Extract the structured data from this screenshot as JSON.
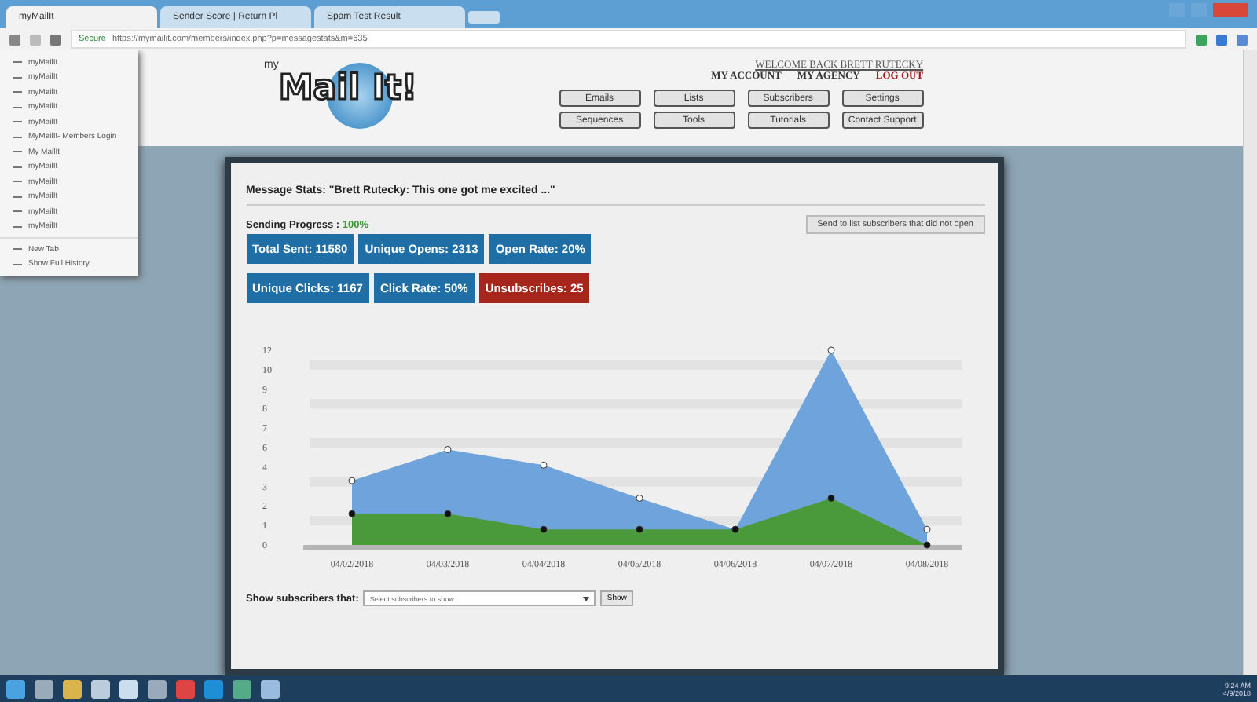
{
  "browser": {
    "tabs": [
      {
        "title": "myMailIt",
        "selected": true
      },
      {
        "title": "Sender Score | Return Pl",
        "selected": false
      },
      {
        "title": "Spam Test Result",
        "selected": false
      }
    ],
    "secure_label": "Secure",
    "url": "https://mymailit.com/members/index.php?p=messagestats&m=635",
    "history_menu": {
      "items": [
        "myMailIt",
        "myMailIt",
        "myMailIt",
        "myMailIt",
        "myMailIt",
        "MyMailIt- Members Login",
        "My MailIt",
        "myMailIt",
        "myMailIt",
        "myMailIt",
        "myMailIt",
        "myMailIt"
      ],
      "actions": [
        "New Tab",
        "Show Full History"
      ]
    }
  },
  "header": {
    "logo": {
      "prefix": "my",
      "text": "Mail It!"
    },
    "welcome": "WELCOME BACK BRETT RUTECKY",
    "account_links": [
      {
        "label": "MY ACCOUNT",
        "kind": "normal"
      },
      {
        "label": "MY AGENCY",
        "kind": "normal"
      },
      {
        "label": "LOG OUT",
        "kind": "logout"
      }
    ],
    "nav_buttons": [
      "Emails",
      "Lists",
      "Subscribers",
      "Settings",
      "Sequences",
      "Tools",
      "Tutorials",
      "Contact Support"
    ]
  },
  "stats": {
    "title": "Message Stats: \"Brett Rutecky: This one got me excited ...\"",
    "progress_label": "Sending Progress :",
    "progress_value": "100%",
    "resend_button": "Send to list subscribers that did not open",
    "tiles": [
      [
        {
          "text": "Total Sent: 11580",
          "color": "#1f6fa6"
        },
        {
          "text": "Unique Opens: 2313",
          "color": "#1f6fa6"
        },
        {
          "text": "Open Rate: 20%",
          "color": "#1f6fa6"
        }
      ],
      [
        {
          "text": "Unique Clicks: 1167",
          "color": "#1f6fa6"
        },
        {
          "text": "Click Rate: 50%",
          "color": "#1f6fa6"
        },
        {
          "text": "Unsubscribes: 25",
          "color": "#a6261c"
        }
      ]
    ],
    "chart": {
      "x_labels": [
        "04/02/2018",
        "04/03/2018",
        "04/04/2018",
        "04/05/2018",
        "04/06/2018",
        "04/07/2018",
        "04/08/2018"
      ],
      "y_labels": [
        "12",
        "10",
        "9",
        "8",
        "7",
        "6",
        "4",
        "3",
        "2",
        "1",
        "0"
      ]
    },
    "filter_label": "Show subscribers that:",
    "filter_placeholder": "Select subscribers to show",
    "filter_button": "Show"
  },
  "taskbar": {
    "time": "9:24 AM",
    "date": "4/9/2018"
  }
}
